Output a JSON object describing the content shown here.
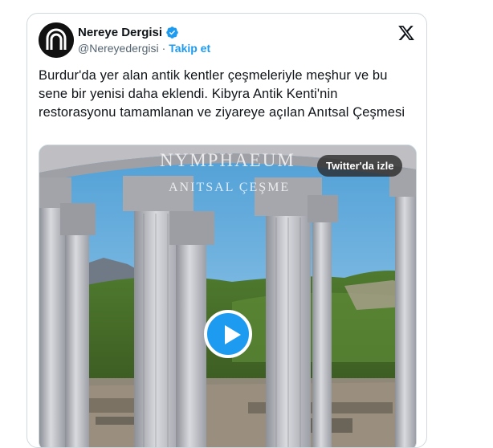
{
  "account": {
    "display_name": "Nereye Dergisi",
    "handle": "@Nereyedergisi",
    "separator": "·",
    "follow_label": "Takip et"
  },
  "tweet": {
    "text": "Burdur'da yer alan antik kentler çeşmeleriyle meşhur ve bu sene bir yenisi daha eklendi. Kibyra Antik Kenti'nin restorasyonu tamamlanan ve ziyareye açılan Anıtsal Çeşmesi"
  },
  "media": {
    "overlay_title": "NYMPHAEUM",
    "overlay_subtitle": "ANITSAL ÇEŞME",
    "watch_label": "Twitter'da izle"
  },
  "icons": {
    "logo": "x-logo-icon",
    "verified": "verified-badge-icon",
    "play": "play-icon",
    "avatar": "nereye-logo-icon"
  },
  "colors": {
    "accent": "#1d9bf0",
    "text": "#0f1419",
    "muted": "#536471",
    "border": "#cfd9de"
  }
}
